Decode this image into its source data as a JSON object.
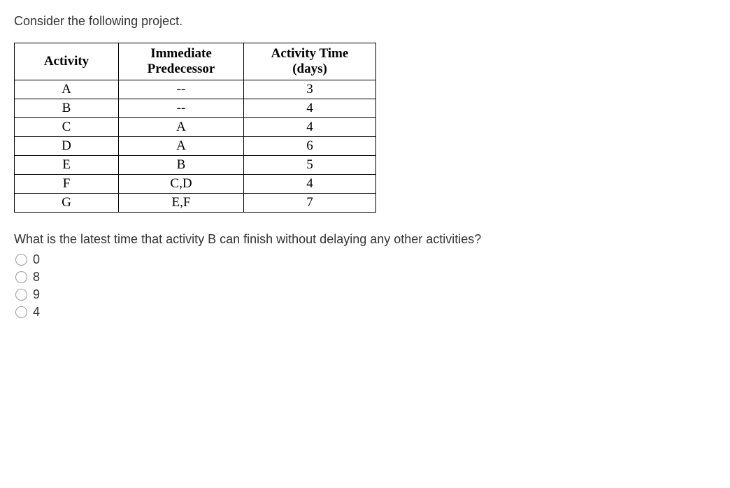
{
  "prompt": "Consider the following project.",
  "table": {
    "headers": {
      "activity": "Activity",
      "predecessor_l1": "Immediate",
      "predecessor_l2": "Predecessor",
      "time_l1": "Activity Time",
      "time_l2": "(days)"
    },
    "rows": [
      {
        "activity": "A",
        "predecessor": "--",
        "time": "3"
      },
      {
        "activity": "B",
        "predecessor": "--",
        "time": "4"
      },
      {
        "activity": "C",
        "predecessor": "A",
        "time": "4"
      },
      {
        "activity": "D",
        "predecessor": "A",
        "time": "6"
      },
      {
        "activity": "E",
        "predecessor": "B",
        "time": "5"
      },
      {
        "activity": "F",
        "predecessor": "C,D",
        "time": "4"
      },
      {
        "activity": "G",
        "predecessor": "E,F",
        "time": "7"
      }
    ]
  },
  "question": "What is the latest time that activity B can finish without delaying any other activities?",
  "options": [
    "0",
    "8",
    "9",
    "4"
  ]
}
